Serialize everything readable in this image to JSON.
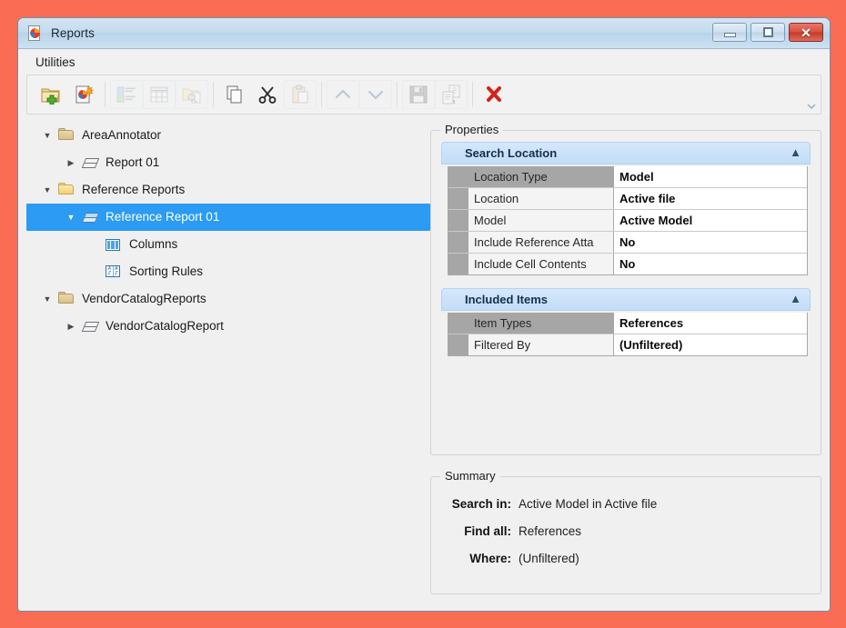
{
  "window": {
    "title": "Reports",
    "icon": "report-document-icon",
    "buttons": {
      "minimize": "Minimize",
      "maximize": "Maximize",
      "close": "Close"
    }
  },
  "menubar": {
    "items": [
      {
        "label": "Utilities",
        "name": "menu-utilities"
      }
    ]
  },
  "toolbar": {
    "overflow_label": "Toolbar options",
    "buttons": [
      {
        "name": "new-report-folder-button",
        "icon": "folder-add-icon",
        "tooltip": "New Report Folder",
        "enabled": true,
        "framed": false
      },
      {
        "name": "new-report-button",
        "icon": "new-report-icon",
        "tooltip": "New Report",
        "enabled": true,
        "framed": false
      },
      {
        "sep": true
      },
      {
        "name": "columns-button",
        "icon": "list-columns-icon",
        "tooltip": "Columns",
        "enabled": false,
        "framed": true
      },
      {
        "name": "table-button",
        "icon": "grid-table-icon",
        "tooltip": "Table",
        "enabled": false,
        "framed": true
      },
      {
        "name": "open-report-button",
        "icon": "folder-search-icon",
        "tooltip": "Open Report",
        "enabled": false,
        "framed": true
      },
      {
        "sep": true
      },
      {
        "name": "copy-button",
        "icon": "copy-icon",
        "tooltip": "Copy",
        "enabled": true,
        "framed": false
      },
      {
        "name": "cut-button",
        "icon": "scissors-icon",
        "tooltip": "Cut",
        "enabled": true,
        "framed": false
      },
      {
        "name": "paste-button",
        "icon": "clipboard-paste-icon",
        "tooltip": "Paste",
        "enabled": false,
        "framed": true
      },
      {
        "sep": true
      },
      {
        "name": "move-up-button",
        "icon": "chevron-up-icon",
        "tooltip": "Move Up",
        "enabled": false,
        "framed": true
      },
      {
        "name": "move-down-button",
        "icon": "chevron-down-icon",
        "tooltip": "Move Down",
        "enabled": false,
        "framed": true
      },
      {
        "sep": true
      },
      {
        "name": "save-button",
        "icon": "floppy-save-icon",
        "tooltip": "Save",
        "enabled": false,
        "framed": true
      },
      {
        "name": "export-button",
        "icon": "export-document-icon",
        "tooltip": "Export",
        "enabled": false,
        "framed": true
      },
      {
        "sep": true
      },
      {
        "name": "delete-button",
        "icon": "red-x-icon",
        "tooltip": "Delete",
        "enabled": true,
        "framed": false
      }
    ]
  },
  "tree": {
    "nodes": [
      {
        "name": "tree-node-areaannotator",
        "label": "AreaAnnotator",
        "icon": "folder-icon",
        "indent": 0,
        "twisty": "expanded",
        "selected": false
      },
      {
        "name": "tree-node-report-01",
        "label": "Report 01",
        "icon": "report-icon",
        "indent": 1,
        "twisty": "collapsed",
        "selected": false
      },
      {
        "name": "tree-node-reference-reports",
        "label": "Reference Reports",
        "icon": "folder-open-icon",
        "indent": 0,
        "twisty": "expanded",
        "selected": false
      },
      {
        "name": "tree-node-reference-report-01",
        "label": "Reference Report 01",
        "icon": "report-blue-icon",
        "indent": 1,
        "twisty": "expanded",
        "selected": true
      },
      {
        "name": "tree-node-columns",
        "label": "Columns",
        "icon": "columns-icon",
        "indent": 2,
        "twisty": "none",
        "selected": false
      },
      {
        "name": "tree-node-sorting-rules",
        "label": "Sorting Rules",
        "icon": "sorting-rules-icon",
        "indent": 2,
        "twisty": "none",
        "selected": false
      },
      {
        "name": "tree-node-vendorcatalogreports",
        "label": "VendorCatalogReports",
        "icon": "folder-icon",
        "indent": 0,
        "twisty": "expanded",
        "selected": false
      },
      {
        "name": "tree-node-vendorcatalogreport",
        "label": "VendorCatalogReport",
        "icon": "report-icon",
        "indent": 1,
        "twisty": "collapsed",
        "selected": false
      }
    ]
  },
  "properties": {
    "group_title": "Properties",
    "sections": [
      {
        "name": "section-search-location",
        "title": "Search Location",
        "collapse_icon": "chevron-up-icon",
        "rows": [
          {
            "key": "Location Type",
            "value": "Model"
          },
          {
            "key": "Location",
            "value": "Active file"
          },
          {
            "key": "Model",
            "value": "Active Model"
          },
          {
            "key": "Include Reference Atta",
            "value": "No"
          },
          {
            "key": "Include Cell Contents",
            "value": "No"
          }
        ]
      },
      {
        "name": "section-included-items",
        "title": "Included Items",
        "collapse_icon": "chevron-up-icon",
        "rows": [
          {
            "key": "Item Types",
            "value": "References"
          },
          {
            "key": "Filtered By",
            "value": "(Unfiltered)"
          }
        ]
      }
    ]
  },
  "summary": {
    "group_title": "Summary",
    "rows": [
      {
        "name": "summary-search-in",
        "label": "Search in:",
        "value": "Active Model  in Active file"
      },
      {
        "name": "summary-find-all",
        "label": "Find all:",
        "value": "References"
      },
      {
        "name": "summary-where",
        "label": "Where:",
        "value": "(Unfiltered)"
      }
    ]
  },
  "colors": {
    "desktop_background": "#fa6c53",
    "selection_blue": "#2b9bf4",
    "section_header_blue": "#c9e0f9",
    "close_button_red": "#c23a29",
    "delete_x_red": "#d4231c"
  }
}
